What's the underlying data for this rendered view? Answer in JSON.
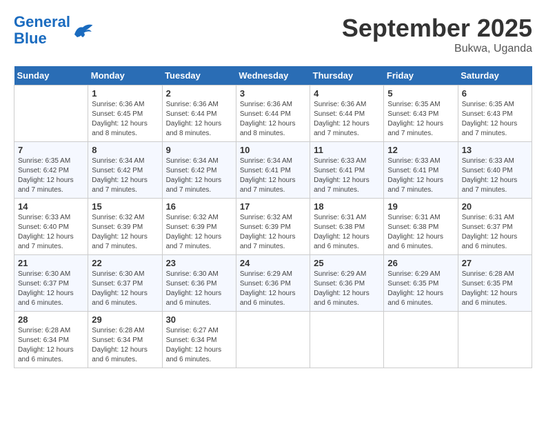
{
  "logo": {
    "line1": "General",
    "line2": "Blue"
  },
  "title": "September 2025",
  "location": "Bukwa, Uganda",
  "days_of_week": [
    "Sunday",
    "Monday",
    "Tuesday",
    "Wednesday",
    "Thursday",
    "Friday",
    "Saturday"
  ],
  "weeks": [
    [
      {
        "day": "",
        "sunrise": "",
        "sunset": "",
        "daylight": ""
      },
      {
        "day": "1",
        "sunrise": "Sunrise: 6:36 AM",
        "sunset": "Sunset: 6:45 PM",
        "daylight": "Daylight: 12 hours and 8 minutes."
      },
      {
        "day": "2",
        "sunrise": "Sunrise: 6:36 AM",
        "sunset": "Sunset: 6:44 PM",
        "daylight": "Daylight: 12 hours and 8 minutes."
      },
      {
        "day": "3",
        "sunrise": "Sunrise: 6:36 AM",
        "sunset": "Sunset: 6:44 PM",
        "daylight": "Daylight: 12 hours and 8 minutes."
      },
      {
        "day": "4",
        "sunrise": "Sunrise: 6:36 AM",
        "sunset": "Sunset: 6:44 PM",
        "daylight": "Daylight: 12 hours and 7 minutes."
      },
      {
        "day": "5",
        "sunrise": "Sunrise: 6:35 AM",
        "sunset": "Sunset: 6:43 PM",
        "daylight": "Daylight: 12 hours and 7 minutes."
      },
      {
        "day": "6",
        "sunrise": "Sunrise: 6:35 AM",
        "sunset": "Sunset: 6:43 PM",
        "daylight": "Daylight: 12 hours and 7 minutes."
      }
    ],
    [
      {
        "day": "7",
        "sunrise": "Sunrise: 6:35 AM",
        "sunset": "Sunset: 6:42 PM",
        "daylight": "Daylight: 12 hours and 7 minutes."
      },
      {
        "day": "8",
        "sunrise": "Sunrise: 6:34 AM",
        "sunset": "Sunset: 6:42 PM",
        "daylight": "Daylight: 12 hours and 7 minutes."
      },
      {
        "day": "9",
        "sunrise": "Sunrise: 6:34 AM",
        "sunset": "Sunset: 6:42 PM",
        "daylight": "Daylight: 12 hours and 7 minutes."
      },
      {
        "day": "10",
        "sunrise": "Sunrise: 6:34 AM",
        "sunset": "Sunset: 6:41 PM",
        "daylight": "Daylight: 12 hours and 7 minutes."
      },
      {
        "day": "11",
        "sunrise": "Sunrise: 6:33 AM",
        "sunset": "Sunset: 6:41 PM",
        "daylight": "Daylight: 12 hours and 7 minutes."
      },
      {
        "day": "12",
        "sunrise": "Sunrise: 6:33 AM",
        "sunset": "Sunset: 6:41 PM",
        "daylight": "Daylight: 12 hours and 7 minutes."
      },
      {
        "day": "13",
        "sunrise": "Sunrise: 6:33 AM",
        "sunset": "Sunset: 6:40 PM",
        "daylight": "Daylight: 12 hours and 7 minutes."
      }
    ],
    [
      {
        "day": "14",
        "sunrise": "Sunrise: 6:33 AM",
        "sunset": "Sunset: 6:40 PM",
        "daylight": "Daylight: 12 hours and 7 minutes."
      },
      {
        "day": "15",
        "sunrise": "Sunrise: 6:32 AM",
        "sunset": "Sunset: 6:39 PM",
        "daylight": "Daylight: 12 hours and 7 minutes."
      },
      {
        "day": "16",
        "sunrise": "Sunrise: 6:32 AM",
        "sunset": "Sunset: 6:39 PM",
        "daylight": "Daylight: 12 hours and 7 minutes."
      },
      {
        "day": "17",
        "sunrise": "Sunrise: 6:32 AM",
        "sunset": "Sunset: 6:39 PM",
        "daylight": "Daylight: 12 hours and 7 minutes."
      },
      {
        "day": "18",
        "sunrise": "Sunrise: 6:31 AM",
        "sunset": "Sunset: 6:38 PM",
        "daylight": "Daylight: 12 hours and 6 minutes."
      },
      {
        "day": "19",
        "sunrise": "Sunrise: 6:31 AM",
        "sunset": "Sunset: 6:38 PM",
        "daylight": "Daylight: 12 hours and 6 minutes."
      },
      {
        "day": "20",
        "sunrise": "Sunrise: 6:31 AM",
        "sunset": "Sunset: 6:37 PM",
        "daylight": "Daylight: 12 hours and 6 minutes."
      }
    ],
    [
      {
        "day": "21",
        "sunrise": "Sunrise: 6:30 AM",
        "sunset": "Sunset: 6:37 PM",
        "daylight": "Daylight: 12 hours and 6 minutes."
      },
      {
        "day": "22",
        "sunrise": "Sunrise: 6:30 AM",
        "sunset": "Sunset: 6:37 PM",
        "daylight": "Daylight: 12 hours and 6 minutes."
      },
      {
        "day": "23",
        "sunrise": "Sunrise: 6:30 AM",
        "sunset": "Sunset: 6:36 PM",
        "daylight": "Daylight: 12 hours and 6 minutes."
      },
      {
        "day": "24",
        "sunrise": "Sunrise: 6:29 AM",
        "sunset": "Sunset: 6:36 PM",
        "daylight": "Daylight: 12 hours and 6 minutes."
      },
      {
        "day": "25",
        "sunrise": "Sunrise: 6:29 AM",
        "sunset": "Sunset: 6:36 PM",
        "daylight": "Daylight: 12 hours and 6 minutes."
      },
      {
        "day": "26",
        "sunrise": "Sunrise: 6:29 AM",
        "sunset": "Sunset: 6:35 PM",
        "daylight": "Daylight: 12 hours and 6 minutes."
      },
      {
        "day": "27",
        "sunrise": "Sunrise: 6:28 AM",
        "sunset": "Sunset: 6:35 PM",
        "daylight": "Daylight: 12 hours and 6 minutes."
      }
    ],
    [
      {
        "day": "28",
        "sunrise": "Sunrise: 6:28 AM",
        "sunset": "Sunset: 6:34 PM",
        "daylight": "Daylight: 12 hours and 6 minutes."
      },
      {
        "day": "29",
        "sunrise": "Sunrise: 6:28 AM",
        "sunset": "Sunset: 6:34 PM",
        "daylight": "Daylight: 12 hours and 6 minutes."
      },
      {
        "day": "30",
        "sunrise": "Sunrise: 6:27 AM",
        "sunset": "Sunset: 6:34 PM",
        "daylight": "Daylight: 12 hours and 6 minutes."
      },
      {
        "day": "",
        "sunrise": "",
        "sunset": "",
        "daylight": ""
      },
      {
        "day": "",
        "sunrise": "",
        "sunset": "",
        "daylight": ""
      },
      {
        "day": "",
        "sunrise": "",
        "sunset": "",
        "daylight": ""
      },
      {
        "day": "",
        "sunrise": "",
        "sunset": "",
        "daylight": ""
      }
    ]
  ]
}
